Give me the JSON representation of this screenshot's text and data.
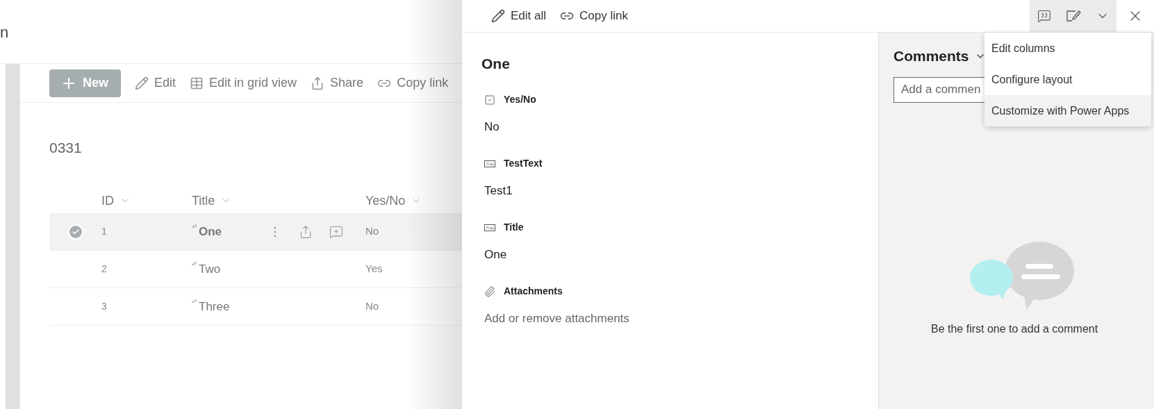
{
  "page": {
    "site_title_fragment": "n",
    "command_bar": [
      {
        "kind": "new",
        "label": "New"
      },
      {
        "kind": "edit",
        "label": "Edit"
      },
      {
        "kind": "grid",
        "label": "Edit in grid view"
      },
      {
        "kind": "share",
        "label": "Share"
      },
      {
        "kind": "link",
        "label": "Copy link"
      }
    ],
    "list_title": "0331",
    "columns": [
      "ID",
      "Title",
      "Yes/No"
    ],
    "rows": [
      {
        "id": "1",
        "title": "One",
        "yes_no": "No",
        "selected": true
      },
      {
        "id": "2",
        "title": "Two",
        "yes_no": "Yes",
        "selected": false
      },
      {
        "id": "3",
        "title": "Three",
        "yes_no": "No",
        "selected": false
      }
    ]
  },
  "panel": {
    "commands": [
      {
        "kind": "edit",
        "label": "Edit all"
      },
      {
        "kind": "link",
        "label": "Copy link"
      }
    ],
    "item_title": "One",
    "fields": [
      {
        "kind": "yesno",
        "label": "Yes/No",
        "value": "No"
      },
      {
        "kind": "text",
        "label": "TestText",
        "value": "Test1"
      },
      {
        "kind": "text",
        "label": "Title",
        "value": "One"
      },
      {
        "kind": "attachment",
        "label": "Attachments",
        "placeholder": "Add or remove attachments"
      }
    ],
    "comments": {
      "heading": "Comments",
      "placeholder": "Add a commen",
      "empty_message": "Be the first one to add a comment"
    },
    "menu": [
      {
        "label": "Edit columns",
        "selected": false
      },
      {
        "label": "Configure layout",
        "selected": false
      },
      {
        "label": "Customize with Power Apps",
        "selected": true
      }
    ]
  }
}
